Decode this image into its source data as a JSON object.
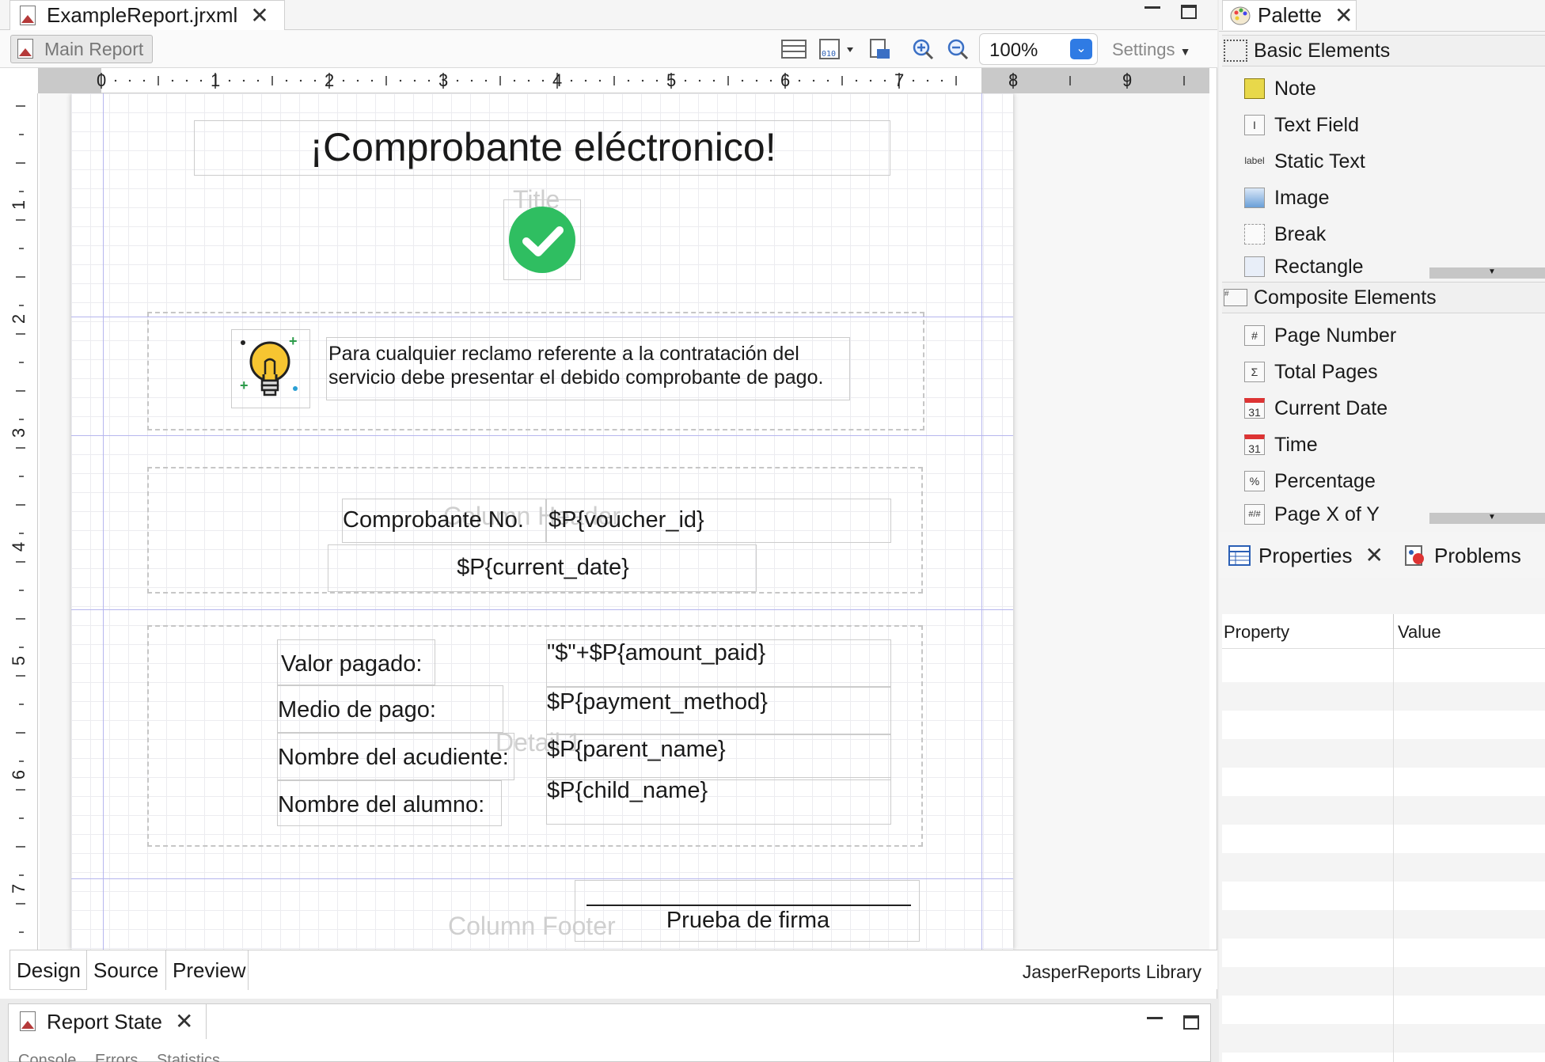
{
  "editor": {
    "tab_title": "ExampleReport.jrxml",
    "main_report_label": "Main Report",
    "zoom": "100%",
    "settings_label": "Settings"
  },
  "ruler": {
    "h_numbers": [
      "0",
      "1",
      "2",
      "3",
      "4",
      "5",
      "6",
      "7",
      "8",
      "9"
    ],
    "v_numbers": [
      "1",
      "2",
      "3",
      "4",
      "5",
      "6",
      "7"
    ]
  },
  "report": {
    "title_text": "¡Comprobante eléctronico!",
    "band_title": "Title",
    "note_text_1": "Para cualquier reclamo referente a la contratación del",
    "note_text_2": "servicio debe presentar el debido comprobante de pago.",
    "band_column_header": "Column Header",
    "voucher_label": "Comprobante No.",
    "voucher_field": "$P{voucher_id}",
    "date_field": "$P{current_date}",
    "band_detail": "Detail 1",
    "valor_label": "Valor pagado:",
    "valor_field": "\"$\"+$P{amount_paid}",
    "medio_label": "Medio de pago:",
    "medio_field": "$P{payment_method}",
    "acudiente_label": "Nombre del acudiente:",
    "acudiente_field": "$P{parent_name}",
    "alumno_label": "Nombre del alumno:",
    "alumno_field": "$P{child_name}",
    "band_column_footer": "Column Footer",
    "signature_label": "Prueba de firma"
  },
  "bottom_tabs": [
    "Design",
    "Source",
    "Preview"
  ],
  "library_label": "JasperReports Library",
  "report_state": {
    "title": "Report State",
    "subtabs": [
      "Console",
      "Errors",
      "Statistics"
    ]
  },
  "palette": {
    "title": "Palette",
    "basic_section": "Basic Elements",
    "basic_items": [
      "Note",
      "Text Field",
      "Static Text",
      "Image",
      "Break",
      "Rectangle"
    ],
    "composite_section": "Composite Elements",
    "composite_items": [
      "Page Number",
      "Total Pages",
      "Current Date",
      "Time",
      "Percentage",
      "Page X of Y"
    ]
  },
  "properties": {
    "tab": "Properties",
    "problems_tab": "Problems",
    "col_property": "Property",
    "col_value": "Value"
  },
  "colors": {
    "accent": "#2f7be4",
    "check_green": "#2fbe61",
    "band_line": "#b6b6ee"
  }
}
